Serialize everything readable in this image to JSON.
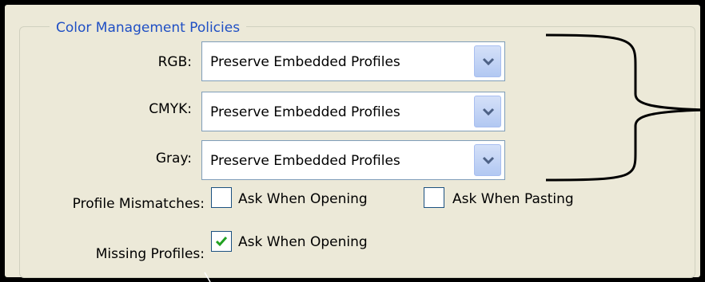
{
  "group": {
    "title": "Color Management Policies"
  },
  "policies": [
    {
      "label": "RGB:",
      "value": "Preserve Embedded Profiles"
    },
    {
      "label": "CMYK:",
      "value": "Preserve Embedded Profiles"
    },
    {
      "label": "Gray:",
      "value": "Preserve Embedded Profiles"
    }
  ],
  "profile_mismatches": {
    "label": "Profile Mismatches:",
    "ask_when_opening": {
      "label": "Ask When Opening",
      "checked": false
    },
    "ask_when_pasting": {
      "label": "Ask When Pasting",
      "checked": false
    }
  },
  "missing_profiles": {
    "label": "Missing Profiles:",
    "ask_when_opening": {
      "label": "Ask When Opening",
      "checked": true
    }
  },
  "colors": {
    "panel": "#ECE9D8",
    "title": "#1F4FC4",
    "checkmark": "#21A121",
    "dropdown_button": "#B2C8F2"
  },
  "icons": {
    "dropdown": "chevron-down-icon",
    "checkmark": "checkmark-icon"
  }
}
